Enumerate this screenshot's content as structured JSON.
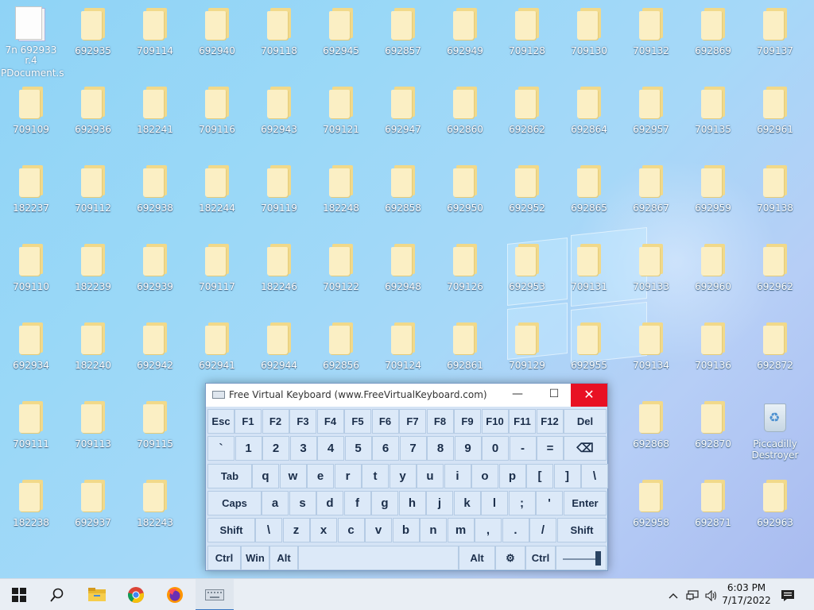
{
  "desktop": {
    "grid": [
      [
        "709109",
        "692936",
        "182241",
        "709116",
        "692943",
        "709121",
        "692947",
        "692860",
        "692862",
        "692864",
        "692957",
        "709135",
        "692961"
      ],
      [
        "182237",
        "709112",
        "692938",
        "182244",
        "709119",
        "182248",
        "692858",
        "692950",
        "692952",
        "692865",
        "692867",
        "692959",
        "709138"
      ],
      [
        "709110",
        "182239",
        "692939",
        "709117",
        "182246",
        "709122",
        "692948",
        "709126",
        "692953",
        "709131",
        "709133",
        "692960",
        "692962"
      ],
      [
        "692934",
        "182240",
        "692942",
        "692941",
        "692944",
        "692856",
        "709124",
        "692861",
        "709129",
        "692955",
        "709134",
        "709136",
        "692872"
      ]
    ],
    "row0": [
      "692935",
      "709114",
      "692940",
      "709118",
      "692945",
      "692857",
      "692949",
      "709128",
      "709130",
      "709132",
      "692869",
      "709137"
    ],
    "row5_left": [
      "709111",
      "709113",
      "709115"
    ],
    "row5_right": [
      "692868",
      "692870"
    ],
    "row6_left": [
      "182238",
      "692937",
      "182243"
    ],
    "row6_right": [
      "692958",
      "692871",
      "692963"
    ],
    "doc_label_line1": "7n 692933 r.4",
    "doc_label_line2": "PDocument.s",
    "recycle_label": "Piccadilly Destroyer"
  },
  "keyboard": {
    "title": "Free Virtual Keyboard (www.FreeVirtualKeyboard.com)",
    "minimize": "—",
    "maximize": "☐",
    "close": "✕",
    "row1": [
      "Esc",
      "F1",
      "F2",
      "F3",
      "F4",
      "F5",
      "F6",
      "F7",
      "F8",
      "F9",
      "F10",
      "F11",
      "F12",
      "Del"
    ],
    "row2": [
      "`",
      "1",
      "2",
      "3",
      "4",
      "5",
      "6",
      "7",
      "8",
      "9",
      "0",
      "-",
      "=",
      "⌫"
    ],
    "row3": [
      "Tab",
      "q",
      "w",
      "e",
      "r",
      "t",
      "y",
      "u",
      "i",
      "o",
      "p",
      "[",
      "]",
      "\\"
    ],
    "row4": [
      "Caps",
      "a",
      "s",
      "d",
      "f",
      "g",
      "h",
      "j",
      "k",
      "l",
      ";",
      "'",
      "Enter"
    ],
    "row5": [
      "Shift",
      "\\",
      "z",
      "x",
      "c",
      "v",
      "b",
      "n",
      "m",
      ",",
      ".",
      "/",
      "Shift"
    ],
    "row6": [
      "Ctrl",
      "Win",
      "Alt",
      "Alt",
      "⚙",
      "Ctrl"
    ]
  },
  "taskbar": {
    "start_icon": "windows-logo",
    "search_icon": "search",
    "apps": [
      "file-explorer",
      "chrome",
      "firefox",
      "virtual-keyboard"
    ],
    "tray_chevron": "^",
    "network_icon": "network",
    "volume_icon": "volume",
    "time": "6:03 PM",
    "date": "7/17/2022",
    "notification_icon": "notifications"
  },
  "colors": {
    "desktop_bg": "#9ad8f7",
    "close_red": "#e81123",
    "key_bg": "#dce9f8",
    "taskbar_bg": "#e9eef4"
  }
}
